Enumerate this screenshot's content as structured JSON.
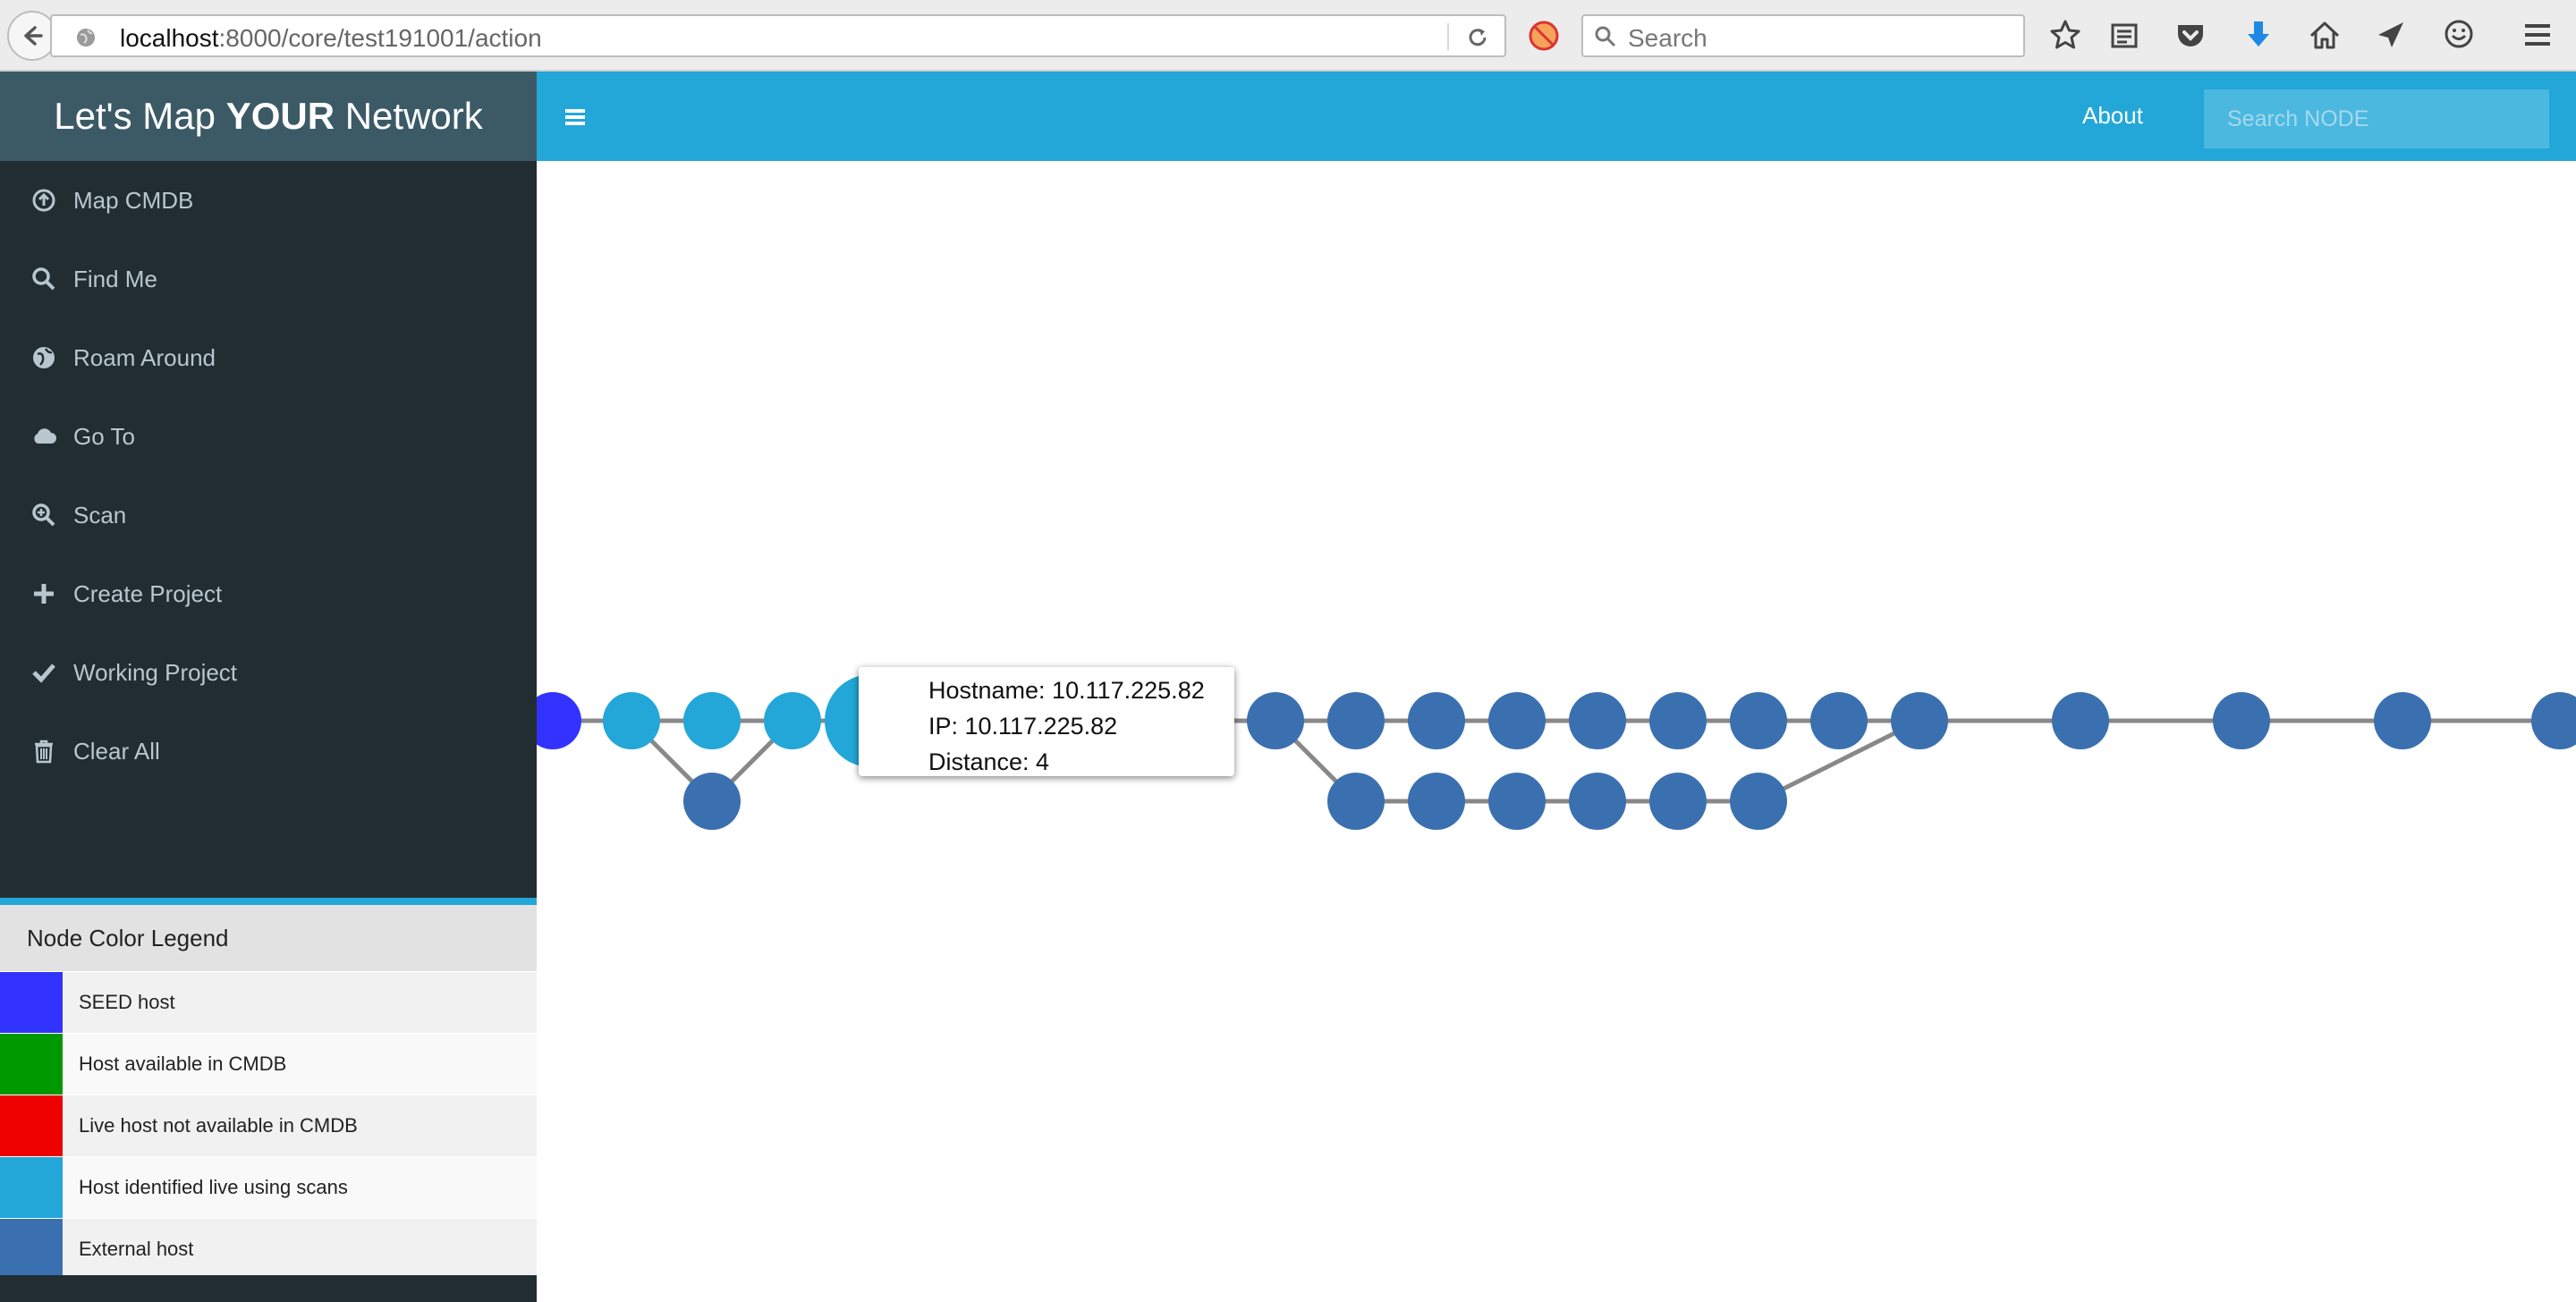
{
  "browser": {
    "url_host": "localhost",
    "url_rest": ":8000/core/test191001/action",
    "search_placeholder": "Search"
  },
  "app": {
    "logo_prefix": "Let's Map ",
    "logo_bold": "YOUR",
    "logo_suffix": " Network"
  },
  "sidebar": {
    "items": [
      {
        "label": "Map CMDB",
        "icon": "upload-circle-icon"
      },
      {
        "label": "Find Me",
        "icon": "search-icon"
      },
      {
        "label": "Roam Around",
        "icon": "globe-icon"
      },
      {
        "label": "Go To",
        "icon": "cloud-icon"
      },
      {
        "label": "Scan",
        "icon": "zoom-in-icon"
      },
      {
        "label": "Create Project",
        "icon": "plus-icon"
      },
      {
        "label": "Working Project",
        "icon": "check-icon"
      },
      {
        "label": "Clear All",
        "icon": "trash-icon"
      }
    ]
  },
  "topbar": {
    "about_label": "About",
    "search_placeholder": "Search NODE"
  },
  "legend": {
    "title": "Node Color Legend",
    "items": [
      {
        "label": "SEED host",
        "color": "#3333ff"
      },
      {
        "label": "Host available in CMDB",
        "color": "#009900"
      },
      {
        "label": "Live host not available in CMDB",
        "color": "#ee0000"
      },
      {
        "label": "Host identified live using scans",
        "color": "#22a7d8"
      },
      {
        "label": "External host",
        "color": "#3a70b0"
      }
    ]
  },
  "tooltip": {
    "hostname": "Hostname: 10.117.225.82",
    "ip": "IP: 10.117.225.82",
    "distance": "Distance: 4"
  },
  "colors": {
    "seed": "#3333ff",
    "scan_live": "#22a7d8",
    "external": "#3a70b0",
    "link": "#888888"
  }
}
